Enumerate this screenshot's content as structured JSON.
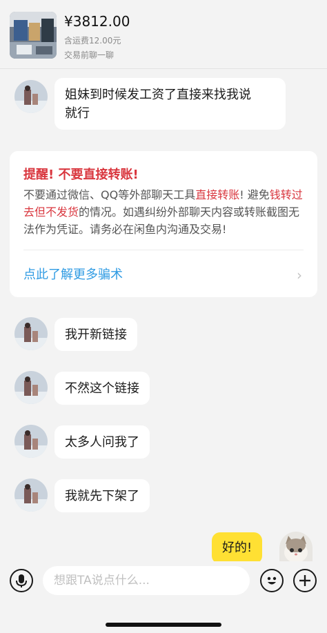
{
  "product": {
    "price": "¥3812.00",
    "shipping": "含运费12.00元",
    "chat_note": "交易前聊一聊"
  },
  "messages": [
    {
      "line1": "姐妹到时候发工资了直接来找我说",
      "line2": "就行"
    },
    {
      "text": "我开新链接"
    },
    {
      "text": "不然这个链接"
    },
    {
      "text": "太多人问我了"
    },
    {
      "text": "我就先下架了"
    },
    {
      "text": "好的!"
    }
  ],
  "warning": {
    "title": "提醒! 不要直接转账!",
    "body_1": "不要通过微信、QQ等外部聊天工具",
    "body_hl_1": "直接转账",
    "body_2": "! 避免",
    "body_hl_2": "钱转过去但不发货",
    "body_3": "的情况。如遇纠纷外部聊天内容或转账截图无法作为凭证。请务必在闲鱼内沟通及交易!",
    "link": "点此了解更多骗术",
    "chevron": "›"
  },
  "input": {
    "placeholder": "想跟TA说点什么..."
  },
  "icons": {
    "mic": "microphone-icon",
    "emoji": "emoji-icon",
    "plus": "plus-icon",
    "chevron": "chevron-right-icon"
  },
  "colors": {
    "background": "#f3f3f3",
    "bubble_other": "#ffffff",
    "bubble_mine": "#ffe033",
    "warning_red": "#d9363e",
    "link_blue": "#2f9be3"
  }
}
